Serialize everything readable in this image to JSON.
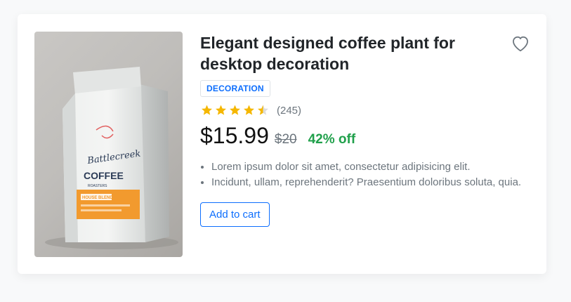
{
  "product": {
    "title": "Elegant designed coffee plant for desktop decoration",
    "tag": "DECORATION",
    "rating": {
      "stars": 4.5,
      "max": 5,
      "reviews": "(245)"
    },
    "price": "$15.99",
    "old_price": "$20",
    "discount": "42% off",
    "features": [
      "Lorem ipsum dolor sit amet, consectetur adipisicing elit.",
      "Incidunt, ullam, reprehenderit? Praesentium doloribus soluta, quia."
    ],
    "cart_label": "Add to cart",
    "image": {
      "brand_line1": "Battlecreek",
      "brand_line2": "COFFEE",
      "brand_line3": "ROASTERS",
      "label": "HOUSE BLEND"
    }
  },
  "colors": {
    "accent": "#0d6efd",
    "star": "#f5b700",
    "discount": "#20a04b",
    "label_orange": "#f29a2e"
  },
  "icons": {
    "favorite": "heart-outline-icon",
    "star": "star-icon"
  }
}
